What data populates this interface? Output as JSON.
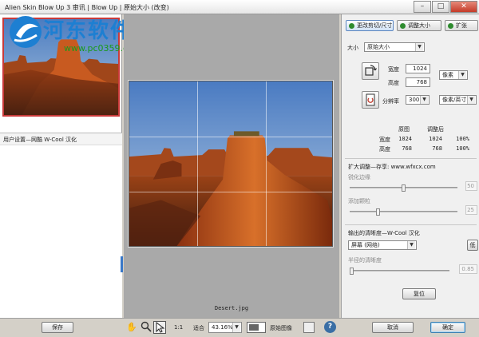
{
  "window": {
    "title": "Alien Skin Blow Up 3 审讯 | Blow Up | 原始大小 (改变)",
    "minimize": "–",
    "maximize": "□",
    "close": "✕"
  },
  "watermark": {
    "title": "河东软件园",
    "url": "www.pc0359.cn"
  },
  "left": {
    "preset_header": "用户设置—网酷 W-Cool 汉化",
    "save_label": "保存"
  },
  "canvas": {
    "filename": "Desert.jpg"
  },
  "tabs": [
    {
      "label": "更改剪切/尺寸",
      "active": true
    },
    {
      "label": "调整大小",
      "active": false
    },
    {
      "label": "扩张",
      "active": false
    }
  ],
  "size": {
    "label": "大小",
    "preset": "原始大小",
    "width_label": "宽度",
    "width_value": "1024",
    "height_label": "高度",
    "height_value": "768",
    "unit": "像素",
    "resolution_label": "分辨率",
    "resolution_value": "300",
    "resolution_unit": "像素/英寸"
  },
  "table": {
    "col_original": "原图",
    "col_adjusted": "调整后",
    "row_width": "宽度",
    "row_height": "高度",
    "width_original": "1024",
    "width_adjusted": "1024",
    "width_pct": "100%",
    "height_original": "768",
    "height_adjusted": "768",
    "height_pct": "100%"
  },
  "enlarge": {
    "header": "扩大调整—存享: www.wfxcx.com",
    "sharpen_label": "锐化边缘",
    "sharpen_value": "50",
    "sharpen_level": 0.5,
    "grain_label": "添加颗粒",
    "grain_value": "25",
    "grain_level": 0.25
  },
  "output": {
    "header": "输出的清晰度—W-Cool 汉化",
    "mode": "屏幕 (网络)",
    "side_button": "低",
    "radius_label": "半径的清晰度",
    "radius_value": "0.85",
    "radius_level": 0.0
  },
  "reset_label": "复位",
  "bottom": {
    "zoom_1to1": "1:1",
    "fit_label": "适合",
    "zoom": "43.16%",
    "original_label": "原始图像",
    "cancel_label": "取消",
    "ok_label": "确定"
  },
  "icons": {
    "hand": "hand-icon",
    "zoom": "magnifier-icon",
    "pointer": "arrow-pointer-icon",
    "help": "help-icon"
  },
  "colors": {
    "accent": "#3c7fb1",
    "sky": "#6e93c4",
    "rock": "#b4501e",
    "selection_border": "#c93a3a"
  }
}
